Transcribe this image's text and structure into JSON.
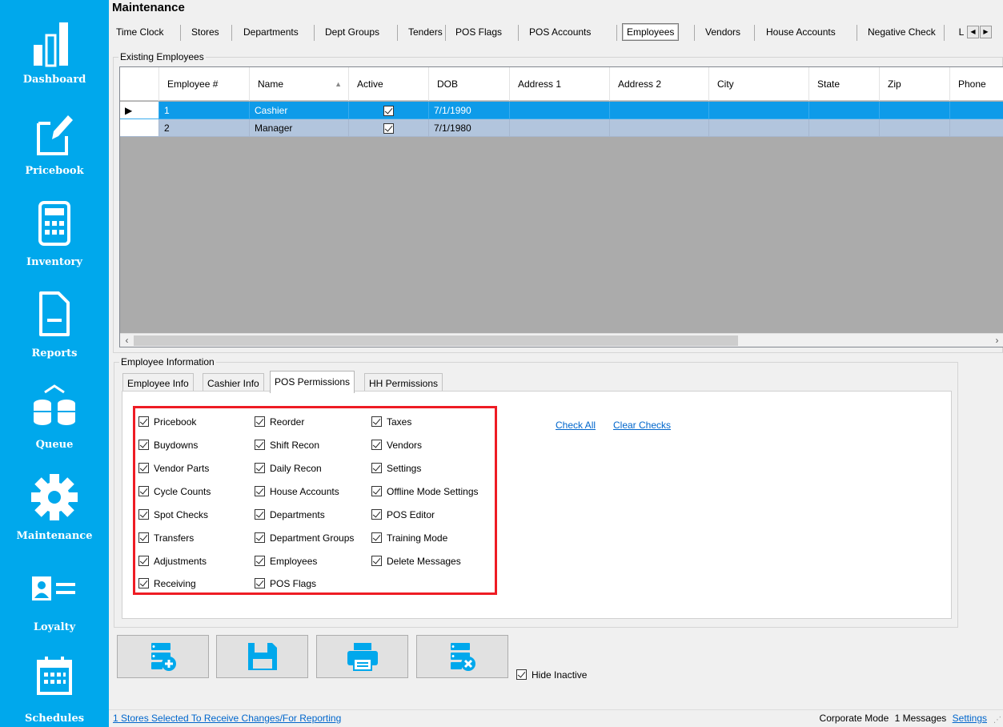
{
  "sidebar": {
    "items": [
      {
        "label": "Dashboard",
        "icon": "bar-chart-icon"
      },
      {
        "label": "Pricebook",
        "icon": "edit-document-icon"
      },
      {
        "label": "Inventory",
        "icon": "calculator-icon"
      },
      {
        "label": "Reports",
        "icon": "report-document-icon"
      },
      {
        "label": "Queue",
        "icon": "database-sync-icon"
      },
      {
        "label": "Maintenance",
        "icon": "gear-icon"
      },
      {
        "label": "Loyalty",
        "icon": "id-card-icon"
      },
      {
        "label": "Schedules",
        "icon": "calendar-icon"
      }
    ],
    "color": "#00a8ec"
  },
  "page": {
    "title": "Maintenance"
  },
  "tabs": {
    "items": [
      "Time Clock",
      "Stores",
      "Departments",
      "Dept Groups",
      "Tenders",
      "POS Flags",
      "POS Accounts",
      "Employees",
      "Vendors",
      "House Accounts",
      "Negative Check",
      "L"
    ],
    "active": "Employees"
  },
  "existing": {
    "title": "Existing Employees",
    "columns": [
      "Employee #",
      "Name",
      "Active",
      "DOB",
      "Address 1",
      "Address 2",
      "City",
      "State",
      "Zip",
      "Phone"
    ],
    "rows": [
      {
        "employee_no": "1",
        "name": "Cashier",
        "active": true,
        "dob": "7/1/1990"
      },
      {
        "employee_no": "2",
        "name": "Manager",
        "active": true,
        "dob": "7/1/1980"
      }
    ]
  },
  "info": {
    "title": "Employee Information",
    "tabs": [
      "Employee Info",
      "Cashier Info",
      "POS Permissions",
      "HH Permissions"
    ],
    "active_tab": "POS Permissions",
    "permissions": {
      "col1": [
        "Pricebook",
        "Buydowns",
        "Vendor Parts",
        "Cycle Counts",
        "Spot Checks",
        "Transfers",
        "Adjustments",
        "Receiving"
      ],
      "col2": [
        "Reorder",
        "Shift Recon",
        "Daily Recon",
        "House Accounts",
        "Departments",
        "Department Groups",
        "Employees",
        "POS Flags"
      ],
      "col3": [
        "Taxes",
        "Vendors",
        "Settings",
        "Offline Mode Settings",
        "POS Editor",
        "Training Mode",
        "Delete Messages"
      ]
    },
    "check_all": "Check All",
    "clear_checks": "Clear Checks",
    "highlight_color": "#ee1c24"
  },
  "toolbar": {
    "buttons": [
      {
        "icon": "add-record-icon"
      },
      {
        "icon": "save-icon"
      },
      {
        "icon": "print-icon"
      },
      {
        "icon": "delete-record-icon"
      }
    ],
    "hide_inactive_label": "Hide Inactive",
    "hide_inactive_checked": true
  },
  "status": {
    "left": "1 Stores Selected To Receive Changes/For Reporting",
    "mode": "Corporate Mode",
    "messages": "1 Messages",
    "settings": "Settings"
  }
}
